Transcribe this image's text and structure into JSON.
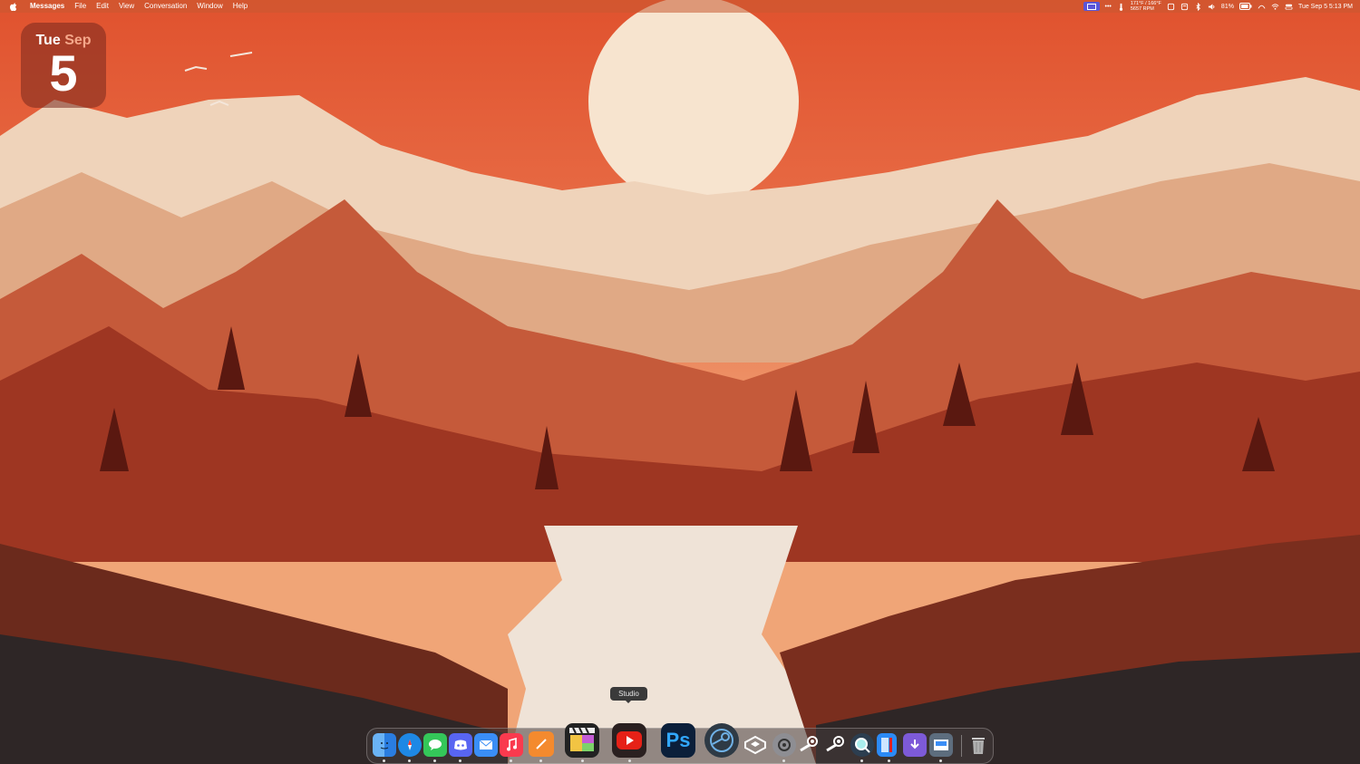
{
  "menubar": {
    "app_name": "Messages",
    "items": [
      "File",
      "Edit",
      "View",
      "Conversation",
      "Window",
      "Help"
    ],
    "status": {
      "temp": "171°F / 166°F",
      "rpm": "5657 RPM",
      "battery": "81%",
      "clock": "Tue Sep 5  5:13 PM"
    }
  },
  "widget": {
    "weekday": "Tue",
    "month": "Sep",
    "day": "5"
  },
  "dock": {
    "tooltip": "Studio",
    "apps": [
      {
        "name": "Finder",
        "icon": "finder-icon",
        "color": "#2a7de1"
      },
      {
        "name": "Safari",
        "icon": "safari-icon",
        "color": "#1e88e5"
      },
      {
        "name": "Messages",
        "icon": "messages-icon",
        "color": "#34c759"
      },
      {
        "name": "Discord",
        "icon": "discord-icon",
        "color": "#5865f2"
      },
      {
        "name": "Mail",
        "icon": "mail-icon",
        "color": "#3a8ef6"
      },
      {
        "name": "Music",
        "icon": "music-icon",
        "color": "#fa3a4e"
      },
      {
        "name": "Pages",
        "icon": "pages-icon",
        "color": "#f48a2e"
      },
      {
        "name": "Final Cut Pro",
        "icon": "final-cut-icon",
        "color": "#222222"
      },
      {
        "name": "YouTube Studio",
        "icon": "youtube-icon",
        "color": "#e62117"
      },
      {
        "name": "Photoshop",
        "icon": "photoshop-icon",
        "label": "Ps",
        "color": "#0b1f3a"
      },
      {
        "name": "Steam Link",
        "icon": "steam-link-icon",
        "color": "#1b5c8a"
      },
      {
        "name": "OpenAI",
        "icon": "openai-icon",
        "color": "#ffffff"
      },
      {
        "name": "System Settings",
        "icon": "settings-icon",
        "color": "#8e8e93"
      },
      {
        "name": "Steam",
        "icon": "steam-icon",
        "color": "#1b2838"
      },
      {
        "name": "Steam",
        "icon": "steam-icon-2",
        "color": "#1b2838"
      },
      {
        "name": "QuickTime",
        "icon": "quicktime-icon",
        "color": "#2c3e50"
      },
      {
        "name": "App Store",
        "icon": "app-store-icon",
        "color": "#2b8af7"
      },
      {
        "name": "Downloads",
        "icon": "downloads-icon",
        "color": "#7d5ad8"
      },
      {
        "name": "Preview",
        "icon": "preview-icon",
        "color": "#5d6d7e"
      },
      {
        "name": "Trash",
        "icon": "trash-icon",
        "color": "#b0b0b0"
      }
    ]
  }
}
